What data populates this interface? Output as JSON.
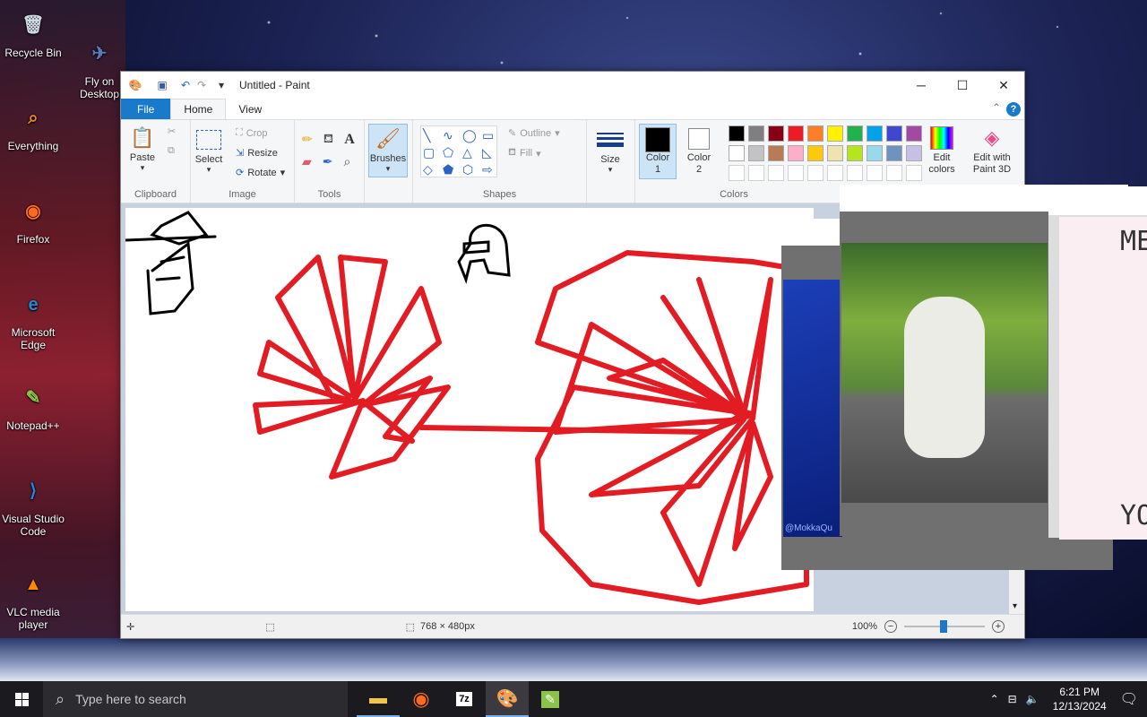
{
  "desktop": {
    "icons": [
      {
        "label": "Recycle Bin",
        "glyph": "🗑",
        "color": "#cfd8e3"
      },
      {
        "label": "Fly on Desktop",
        "glyph": "✈",
        "color": "#5a7ab5"
      },
      {
        "label": "Everything",
        "glyph": "⌕",
        "color": "#f08a1c"
      },
      {
        "label": "Firefox",
        "glyph": "◉",
        "color": "#ff6a1e"
      },
      {
        "label": "Microsoft Edge",
        "glyph": "e",
        "color": "#1e8bd6"
      },
      {
        "label": "Notepad++",
        "glyph": "✎",
        "color": "#8bc34a"
      },
      {
        "label": "Visual Studio Code",
        "glyph": "⟩",
        "color": "#1e88e5"
      },
      {
        "label": "VLC media player",
        "glyph": "▲",
        "color": "#ff8800"
      }
    ]
  },
  "paint": {
    "title": "Untitled - Paint",
    "tabs": {
      "file": "File",
      "home": "Home",
      "view": "View"
    },
    "clipboard": {
      "paste": "Paste",
      "label": "Clipboard"
    },
    "image": {
      "select": "Select",
      "crop": "Crop",
      "resize": "Resize",
      "rotate": "Rotate",
      "label": "Image"
    },
    "tools": {
      "label": "Tools"
    },
    "brushes": "Brushes",
    "shapes": {
      "outline": "Outline",
      "fill": "Fill",
      "label": "Shapes"
    },
    "size": "Size",
    "colors": {
      "color1": "Color 1",
      "color2": "Color 2",
      "edit": "Edit colors",
      "paint3d": "Edit with Paint 3D",
      "label": "Colors",
      "palette_row1": [
        "#000000",
        "#7f7f7f",
        "#880015",
        "#ed1c24",
        "#ff7f27",
        "#fff200",
        "#22b14c",
        "#00a2e8",
        "#3f48cc",
        "#a349a4"
      ],
      "palette_row2": [
        "#ffffff",
        "#c3c3c3",
        "#b97a57",
        "#ffaec9",
        "#ffc90e",
        "#efe4b0",
        "#b5e61d",
        "#99d9ea",
        "#7092be",
        "#c8bfe7"
      ]
    },
    "status": {
      "dimensions": "768 × 480px",
      "zoom": "100%"
    }
  },
  "overlays": {
    "right_text_top": "ME",
    "right_text_bottom": "YO",
    "watermark": "@MokkaQu"
  },
  "taskbar": {
    "search_placeholder": "Type here to search",
    "time": "6:21 PM",
    "date": "12/13/2024"
  }
}
